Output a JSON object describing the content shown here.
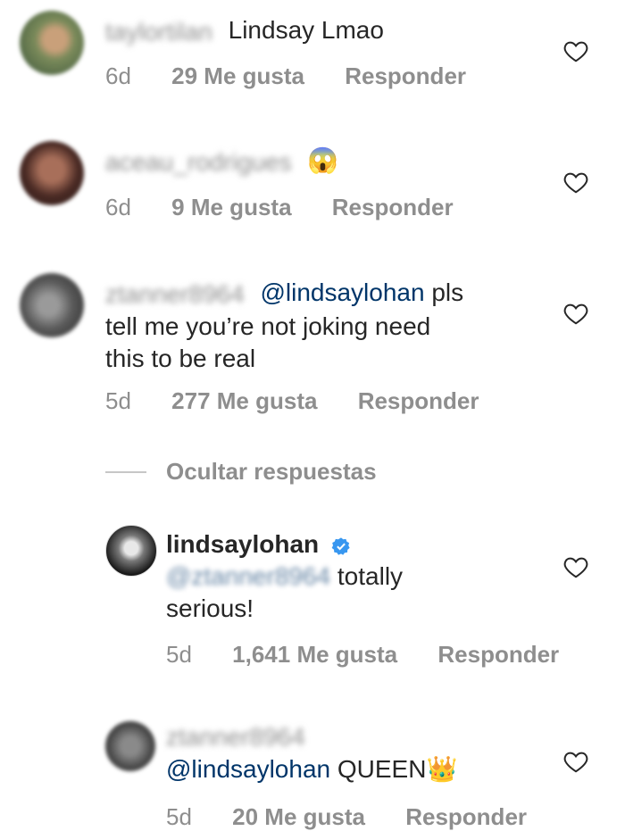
{
  "comments": [
    {
      "username": "taylortilan",
      "text": "Lindsay Lmao",
      "age": "6d",
      "likes": "29 Me gusta",
      "reply": "Responder"
    },
    {
      "username": "aceau_rodrigues",
      "emoji": "😱",
      "age": "6d",
      "likes": "9 Me gusta",
      "reply": "Responder"
    },
    {
      "username": "ztanner8964",
      "mention": "@lindsaylohan",
      "text_line1": " pls",
      "text_line2": "tell me you’re not joking need",
      "text_line3": "this to be real",
      "age": "5d",
      "likes": "277 Me gusta",
      "reply": "Responder"
    }
  ],
  "hide_replies": "Ocultar respuestas",
  "replies": [
    {
      "username": "lindsaylohan",
      "mention": "@ztanner8964",
      "text_line1": " totally",
      "text_line2": "serious!",
      "age": "5d",
      "likes": "1,641 Me gusta",
      "reply": "Responder"
    },
    {
      "username": "ztanner8964",
      "mention": "@lindsaylohan",
      "text": " QUEEN",
      "emoji": "👑",
      "age": "5d",
      "likes": "20 Me gusta",
      "reply": "Responder"
    }
  ],
  "icons": {
    "like": "heart-outline-icon",
    "verified": "verified-badge-icon"
  },
  "colors": {
    "mention": "#003569",
    "meta": "#8e8e8e",
    "text": "#262626",
    "verified": "#3897f0"
  }
}
